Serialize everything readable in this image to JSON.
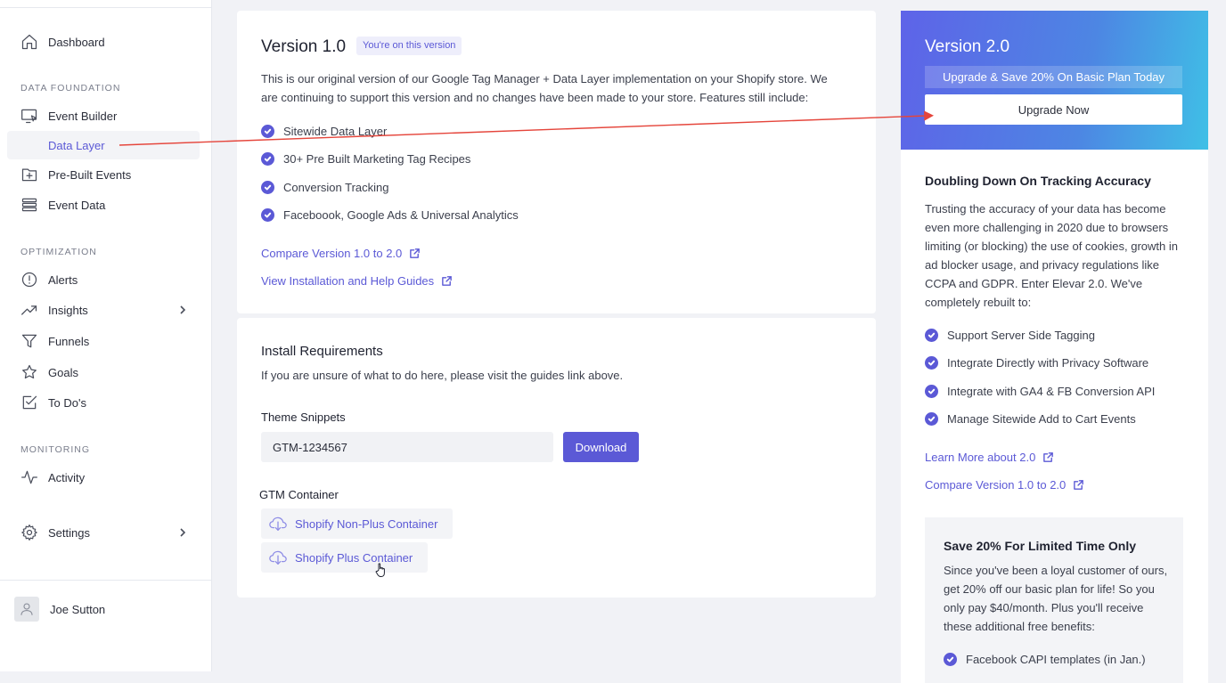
{
  "sidebar": {
    "dashboard": "Dashboard",
    "section_data_foundation": "DATA FOUNDATION",
    "event_builder": "Event Builder",
    "data_layer": "Data Layer",
    "pre_built_events": "Pre-Built Events",
    "event_data": "Event Data",
    "section_optimization": "OPTIMIZATION",
    "alerts": "Alerts",
    "insights": "Insights",
    "funnels": "Funnels",
    "goals": "Goals",
    "todos": "To Do's",
    "section_monitoring": "MONITORING",
    "activity": "Activity",
    "settings": "Settings",
    "user_name": "Joe Sutton"
  },
  "version1": {
    "title": "Version 1.0",
    "badge": "You're on this version",
    "intro": "This is our original version of our Google Tag Manager + Data Layer implementation on your Shopify store. We are continuing to support this version and no changes have been made to your store. Features still include:",
    "features": [
      "Sitewide Data Layer",
      "30+ Pre Built Marketing Tag Recipes",
      "Conversion Tracking",
      "Faceboook, Google Ads & Universal Analytics"
    ],
    "compare_link": "Compare Version 1.0 to 2.0",
    "guides_link": "View Installation and Help Guides"
  },
  "install": {
    "title": "Install Requirements",
    "subtitle": "If you are unsure of what to do here, please visit the guides link above.",
    "snippets_label": "Theme Snippets",
    "snippet_value": "GTM-1234567",
    "download_label": "Download",
    "gtm_label": "GTM Container",
    "non_plus_container": "Shopify Non-Plus Container",
    "plus_container": "Shopify Plus Container"
  },
  "version2": {
    "title": "Version 2.0",
    "strip": "Upgrade & Save 20% On Basic Plan Today",
    "upgrade_button": "Upgrade Now",
    "heading": "Doubling Down On Tracking Accuracy",
    "text": "Trusting the accuracy of your data has become even more challenging in 2020 due to browsers limiting (or blocking) the use of cookies, growth in ad blocker usage, and privacy regulations like CCPA and GDPR. Enter Elevar 2.0. We've completely rebuilt to:",
    "features": [
      "Support Server Side Tagging",
      "Integrate Directly with Privacy Software",
      "Integrate with GA4 & FB Conversion API",
      "Manage Sitewide Add to Cart Events"
    ],
    "learn_more_link": "Learn More about 2.0",
    "compare_link": "Compare Version 1.0 to 2.0",
    "promo_title": "Save 20% For Limited Time Only",
    "promo_text": "Since you've been a loyal customer of ours, get 20% off our basic plan for life! So you only pay $40/month. Plus you'll receive these additional free benefits:",
    "promo_features": [
      "Facebook CAPI templates (in Jan.)"
    ]
  },
  "colors": {
    "accent": "#5b59d6",
    "annotation_arrow": "#e5453b"
  }
}
